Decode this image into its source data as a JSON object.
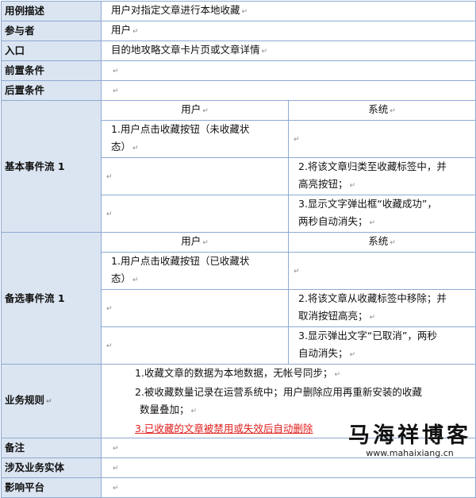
{
  "rows": {
    "desc": {
      "label": "用例描述",
      "value": "用户对指定文章进行本地收藏"
    },
    "actor": {
      "label": "参与者",
      "value": "用户"
    },
    "entry": {
      "label": "入口",
      "value": "目的地攻略文章卡片页或文章详情"
    },
    "pre": {
      "label": "前置条件",
      "value": ""
    },
    "post": {
      "label": "后置条件",
      "value": ""
    }
  },
  "basic_flow": {
    "label": "基本事件流 1",
    "col_user": "用户",
    "col_system": "系统",
    "user_step_1a": "1.用户点击收藏按钮（未收藏状",
    "user_step_1b": "态）",
    "sys_step_2a": "2.将该文章归类至收藏标签中，并",
    "sys_step_2b": "高亮按钮；",
    "sys_step_3a": "3.显示文字弹出框“收藏成功”，",
    "sys_step_3b": "两秒自动消失；"
  },
  "alt_flow": {
    "label": "备选事件流 1",
    "col_user": "用户",
    "col_system": "系统",
    "user_step_1a": "1.用户点击收藏按钮（已收藏状",
    "user_step_1b": "态）",
    "sys_step_2a": "2.将该文章从收藏标签中移除；并",
    "sys_step_2b": "取消按钮高亮；",
    "sys_step_3a": "3.显示弹出文字“已取消”，两秒",
    "sys_step_3b": "自动消失；"
  },
  "rules": {
    "label": "业务规则",
    "r1": "1.收藏文章的数据为本地数据，无帐号同步；",
    "r2a": "2.被收藏数量记录在运营系统中；用户删除应用再重新安装的收藏",
    "r2b": "数量叠加；",
    "r3": "3.已收藏的文章被禁用或失效后自动删除"
  },
  "bottom": {
    "note": "备注",
    "entity": "涉及业务实体",
    "platform": "影响平台"
  },
  "paragraph_mark": "↵",
  "watermark": {
    "title": "马海祥博客",
    "url": "www.mahaixiang.cn"
  },
  "colors": {
    "label_bg": "#dbe5f1",
    "border": "#8ea9d4",
    "highlight": "#e0201f"
  }
}
